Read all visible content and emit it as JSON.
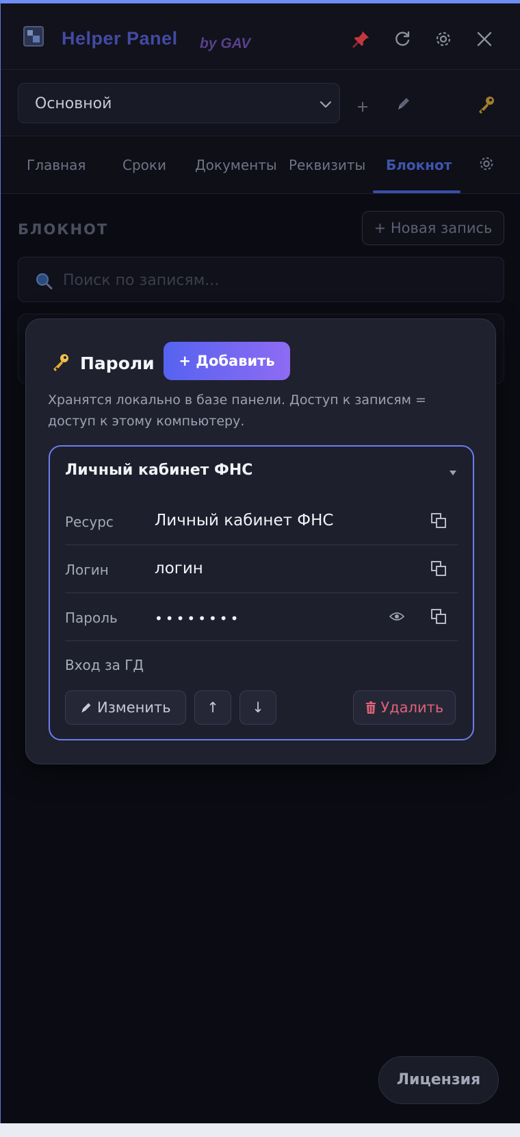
{
  "window": {
    "title": "Helper Panel",
    "author": "by GAV"
  },
  "profile": {
    "selected": "Основной"
  },
  "tabs": [
    {
      "label": "Главная"
    },
    {
      "label": "Сроки"
    },
    {
      "label": "Документы"
    },
    {
      "label": "Реквизиты"
    },
    {
      "label": "Блокнот"
    }
  ],
  "active_tab": "Блокнот",
  "notebook": {
    "heading": "БЛОКНОТ",
    "new_entry_label": "+ Новая запись",
    "search_placeholder": "Поиск по записям..."
  },
  "passwords_modal": {
    "title": "Пароли",
    "add_label": "+ Добавить",
    "description": "Хранятся локально в базе панели. Доступ к записям = доступ к этому компьютеру.",
    "entry": {
      "title": "Личный кабинет ФНС",
      "fields": [
        {
          "label": "Ресурс",
          "value": "Личный кабинет ФНС"
        },
        {
          "label": "Логин",
          "value": "логин"
        },
        {
          "label": "Пароль",
          "value": "••••••••"
        }
      ],
      "note": "Вход за ГД",
      "edit_label": "Изменить",
      "up_label": "↑",
      "down_label": "↓",
      "delete_label": "Удалить"
    }
  },
  "license_label": "Лицензия",
  "colors": {
    "accent": "#6b7ef0",
    "gradient_start": "#5563f0",
    "gradient_end": "#8f6bf3",
    "danger": "#e06277",
    "background": "#0b0c13"
  }
}
